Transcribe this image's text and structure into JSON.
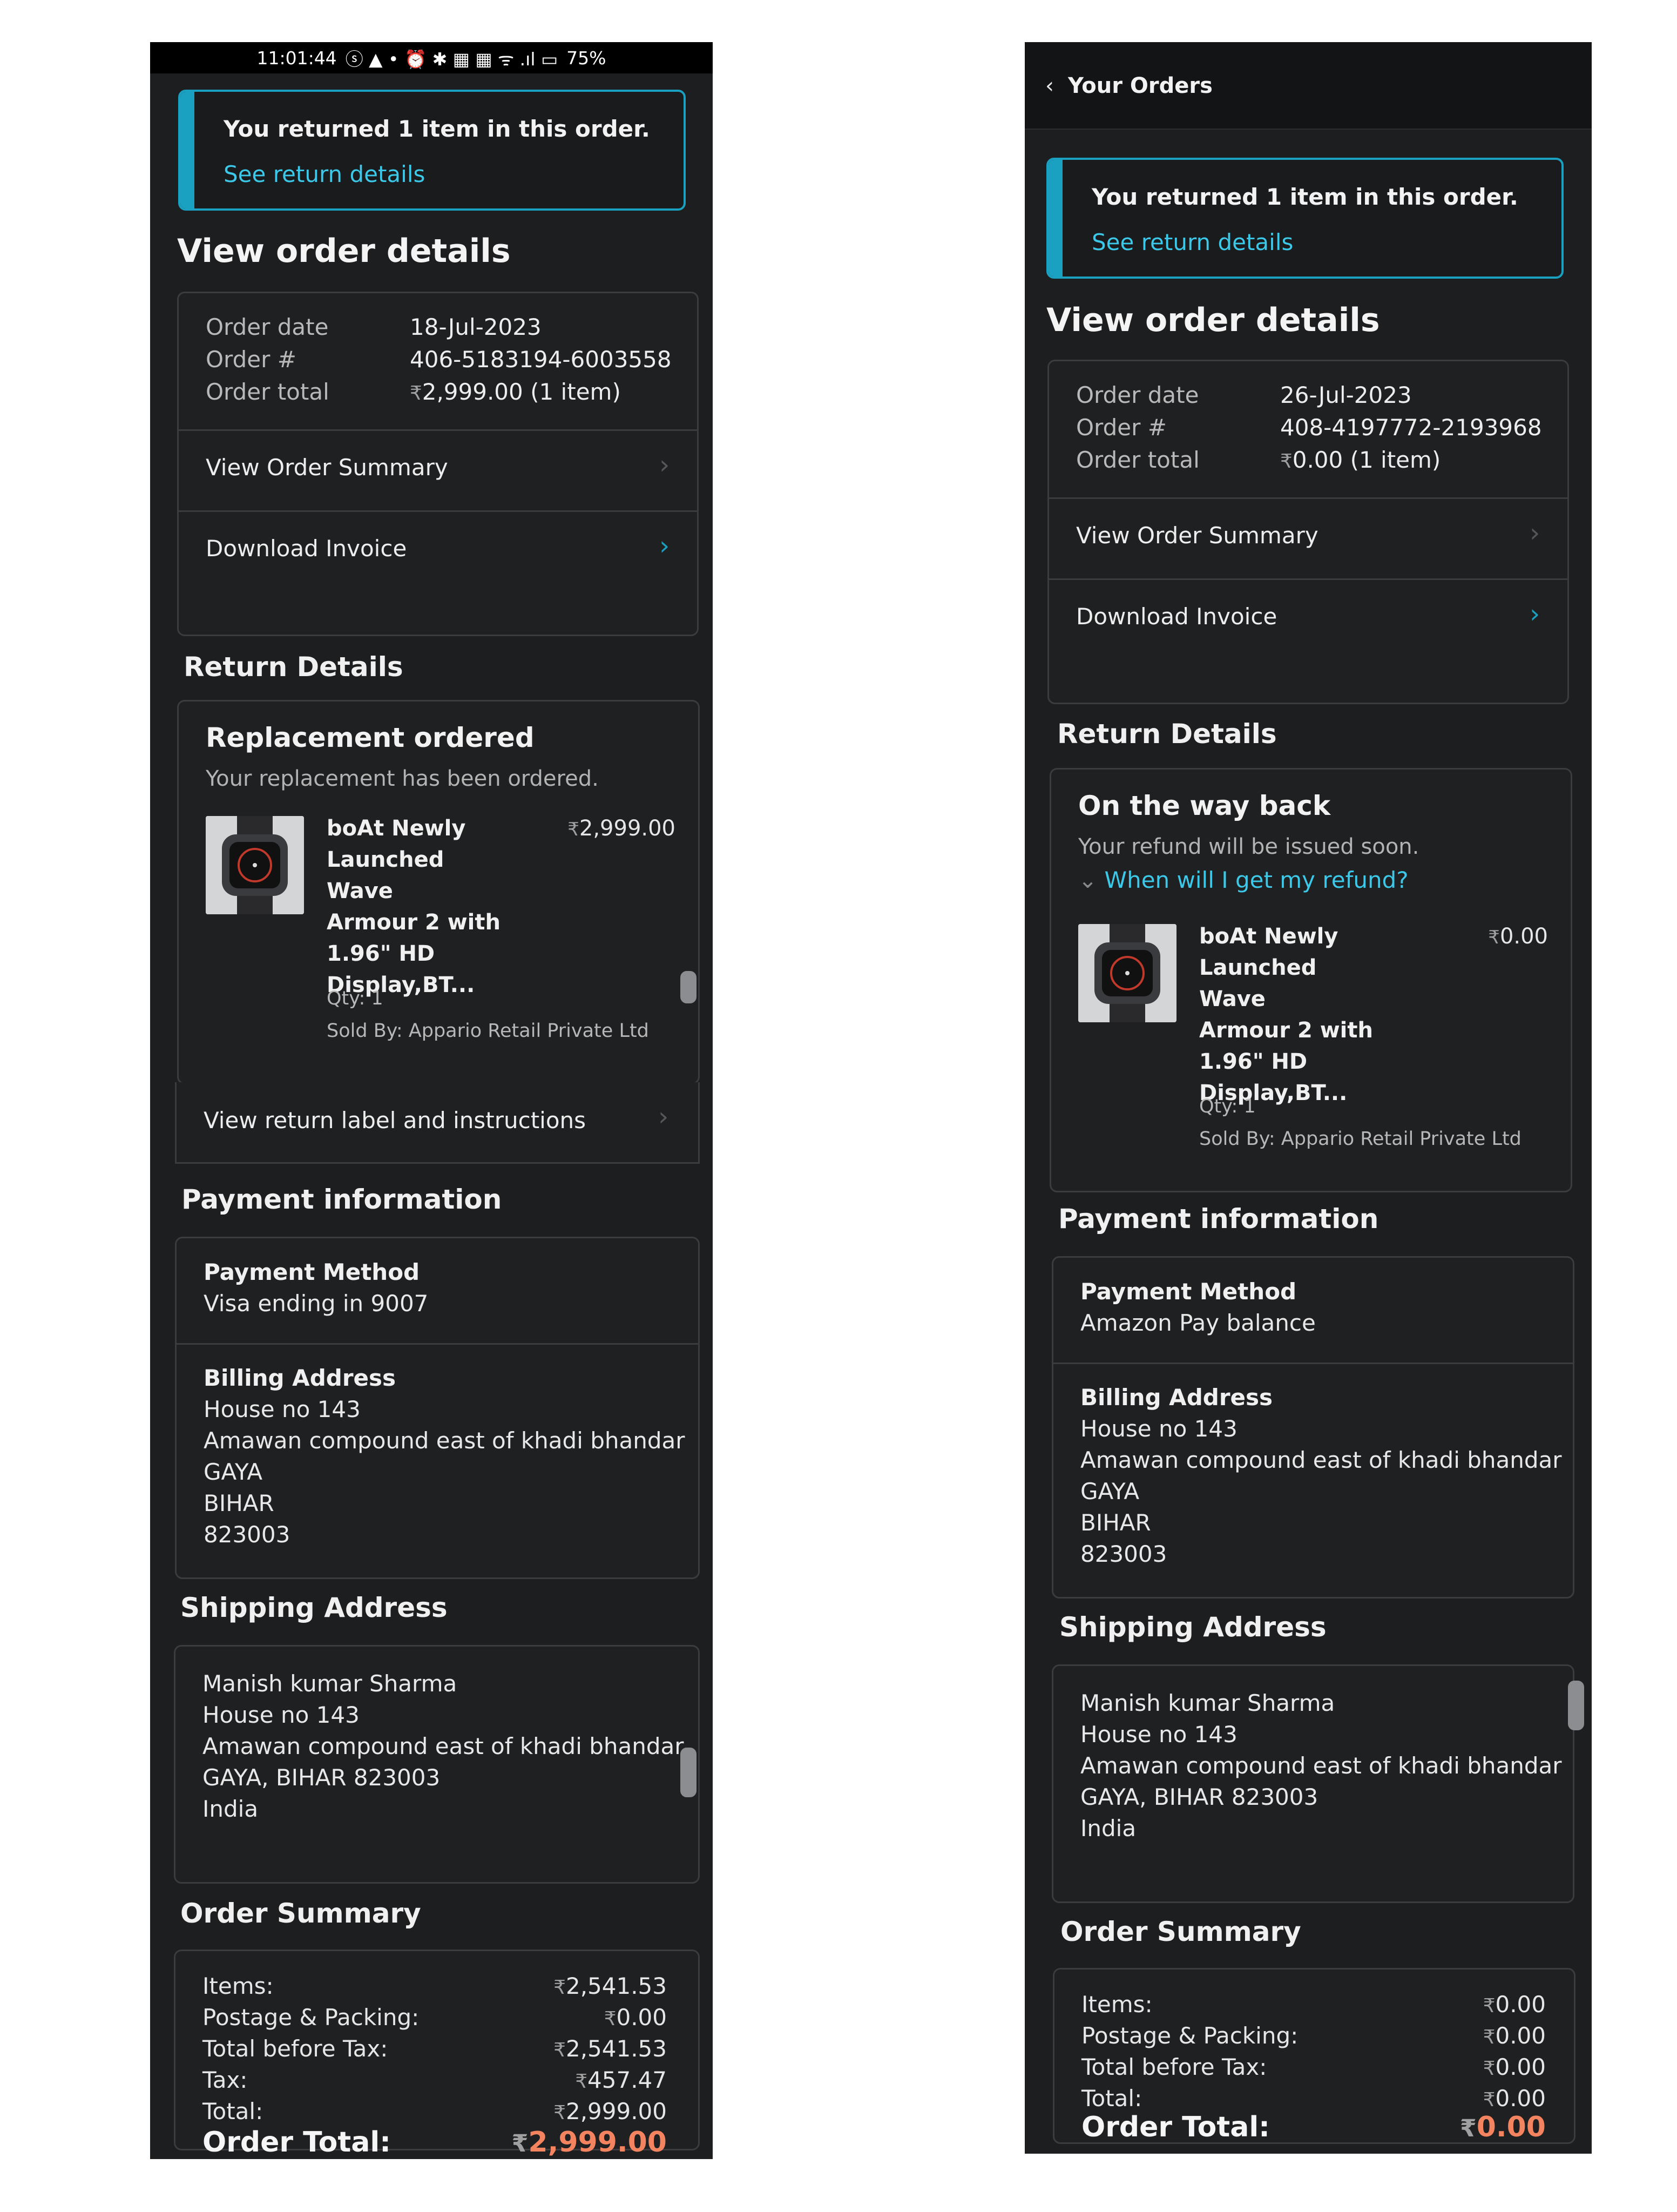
{
  "left": {
    "status_bar": {
      "time": "11:01:44",
      "icons": "ⓢ ▲ •   ⏰ ✱ ▦ ▦ ᯤ .ıl ▭",
      "battery": "75%"
    },
    "alert": {
      "message": "You returned 1 item in this order.",
      "link": "See return details"
    },
    "heading": "View order details",
    "order": {
      "date_label": "Order date",
      "date": "18-Jul-2023",
      "number_label": "Order #",
      "number": "406-5183194-6003558",
      "total_label": "Order total",
      "total_symbol": "₹",
      "total": "2,999.00",
      "total_suffix": " (1 item)"
    },
    "view_summary": "View Order Summary",
    "download_invoice": "Download Invoice",
    "return_heading": "Return Details",
    "return_status": {
      "title": "Replacement ordered",
      "subtitle": "Your replacement has been ordered."
    },
    "product": {
      "name_lines": [
        "boAt Newly",
        "Launched Wave",
        "Armour 2 with",
        "1.96\" HD",
        "Display,BT..."
      ],
      "price_symbol": "₹",
      "price": "2,999.00",
      "qty": "Qty: 1",
      "seller": "Sold By: Appario Retail Private Ltd"
    },
    "return_label": "View return label and instructions",
    "payment_heading": "Payment information",
    "payment": {
      "method_label": "Payment Method",
      "method": "Visa ending in 9007"
    },
    "billing": {
      "label": "Billing Address",
      "lines": [
        "House no 143",
        "Amawan compound east of khadi bhandar",
        "GAYA",
        "BIHAR",
        "823003"
      ]
    },
    "shipping_heading": "Shipping Address",
    "shipping": [
      "Manish kumar Sharma",
      "House no 143",
      "Amawan compound east of khadi bhandar",
      "GAYA, BIHAR 823003",
      "India"
    ],
    "summary_heading": "Order Summary",
    "summary": [
      {
        "label": "Items:",
        "value": "2,541.53"
      },
      {
        "label": "Postage & Packing:",
        "value": "0.00"
      },
      {
        "label": "Total before Tax:",
        "value": "2,541.53"
      },
      {
        "label": "Tax:",
        "value": "457.47"
      },
      {
        "label": "Total:",
        "value": "2,999.00"
      }
    ],
    "order_total_label": "Order Total:",
    "order_total": "2,999.00"
  },
  "right": {
    "nav": {
      "back": "‹",
      "title": "Your Orders"
    },
    "alert": {
      "message": "You returned 1 item in this order.",
      "link": "See return details"
    },
    "heading": "View order details",
    "order": {
      "date_label": "Order date",
      "date": "26-Jul-2023",
      "number_label": "Order #",
      "number": "408-4197772-2193968",
      "total_label": "Order total",
      "total_symbol": "₹",
      "total": "0.00",
      "total_suffix": " (1 item)"
    },
    "view_summary": "View Order Summary",
    "download_invoice": "Download Invoice",
    "return_heading": "Return Details",
    "return_status": {
      "title": "On the way back",
      "subtitle": "Your refund will be issued soon.",
      "refund_link": "When will I get my refund?"
    },
    "product": {
      "name_lines": [
        "boAt Newly",
        "Launched Wave",
        "Armour 2 with",
        "1.96\" HD",
        "Display,BT..."
      ],
      "price_symbol": "₹",
      "price": "0.00",
      "qty": "Qty: 1",
      "seller": "Sold By: Appario Retail Private Ltd"
    },
    "payment_heading": "Payment information",
    "payment": {
      "method_label": "Payment Method",
      "method": "Amazon Pay balance"
    },
    "billing": {
      "label": "Billing Address",
      "lines": [
        "House no 143",
        "Amawan compound east of khadi bhandar",
        "GAYA",
        "BIHAR",
        "823003"
      ]
    },
    "shipping_heading": "Shipping Address",
    "shipping": [
      "Manish kumar Sharma",
      "House no 143",
      "Amawan compound east of khadi bhandar",
      "GAYA, BIHAR 823003",
      "India"
    ],
    "summary_heading": "Order Summary",
    "summary": [
      {
        "label": "Items:",
        "value": "0.00"
      },
      {
        "label": "Postage & Packing:",
        "value": "0.00"
      },
      {
        "label": "Total before Tax:",
        "value": "0.00"
      },
      {
        "label": "Total:",
        "value": "0.00"
      }
    ],
    "order_total_label": "Order Total:",
    "order_total": "0.00"
  },
  "colors": {
    "background": "#1d1e20",
    "accent": "#1aa0c0",
    "link": "#3cc8e8",
    "order_total": "#f4845f"
  },
  "icons": [
    "back-chevron-icon",
    "chevron-right-icon",
    "chevron-down-icon",
    "rupee-icon",
    "watch-thumbnail"
  ]
}
